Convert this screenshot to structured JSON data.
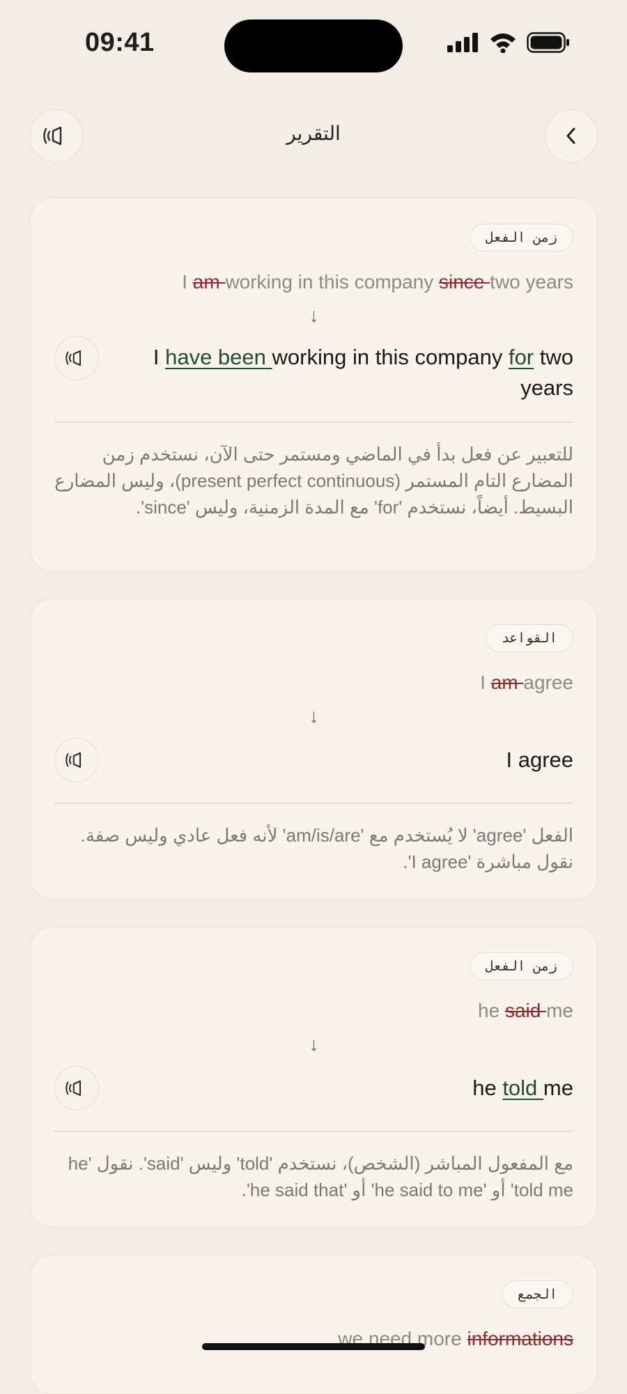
{
  "status": {
    "time": "09:41"
  },
  "header": {
    "title": "التقرير"
  },
  "cards": [
    {
      "badge": "زمن الفعل",
      "orig": {
        "p1": "I ",
        "del1": "am ",
        "p2": "working in this company ",
        "del2": "since ",
        "p3": "two years"
      },
      "arrow": "↓",
      "corr": {
        "p1": "I ",
        "ins1": "have been ",
        "p2": "working in this company ",
        "ins2": "for",
        "p3": " two years"
      },
      "explanation": "للتعبير عن فعل بدأ في الماضي ومستمر حتى الآن، نستخدم زمن المضارع التام المستمر (present perfect continuous)، وليس المضارع البسيط. أيضاً، نستخدم 'for' مع المدة الزمنية، وليس 'since'."
    },
    {
      "badge": "القواعد",
      "orig": {
        "p1": "I ",
        "del1": "am ",
        "p2": "agree"
      },
      "arrow": "↓",
      "corr": {
        "p1": "I agree"
      },
      "explanation": "الفعل 'agree' لا يُستخدم مع 'am/is/are' لأنه فعل عادي وليس صفة. نقول مباشرة 'I agree'."
    },
    {
      "badge": "زمن الفعل",
      "orig": {
        "p1": "he ",
        "del1": "said ",
        "p2": "me"
      },
      "arrow": "↓",
      "corr": {
        "p1": "he ",
        "ins1": "told ",
        "p2": "me"
      },
      "explanation": "مع المفعول المباشر (الشخص)، نستخدم 'told' وليس 'said'. نقول 'he told me' أو 'he said to me' أو 'he said that'."
    },
    {
      "badge": "الجمع",
      "orig": {
        "p1": "we need more ",
        "del1": "informations"
      }
    }
  ],
  "colors": {
    "background": "#F2EEE5",
    "card": "#F8F4EC",
    "deleted": "#8E2B2E",
    "inserted": "#244a32"
  },
  "icons": [
    "back-chevron-icon",
    "speaker-icon",
    "play-audio-icon",
    "signal-icon",
    "wifi-icon",
    "battery-icon"
  ]
}
